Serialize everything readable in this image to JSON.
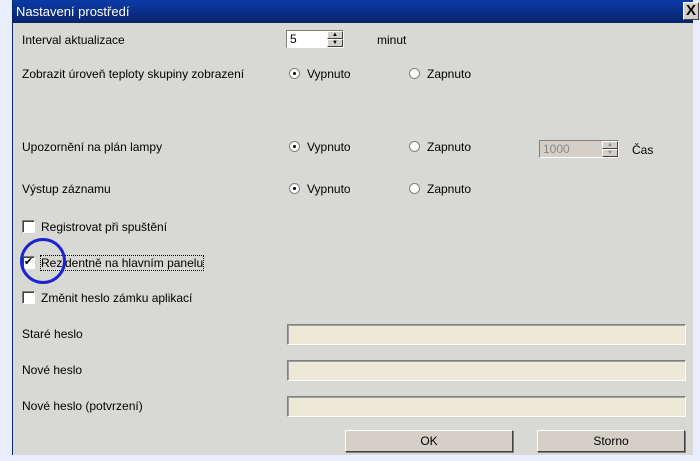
{
  "window": {
    "title": "Nastavení prostředí",
    "close_glyph": "X"
  },
  "update_interval": {
    "label": "Interval aktualizace",
    "value": "5",
    "unit": "minut"
  },
  "temperature": {
    "label": "Zobrazit úroveň teploty skupiny zobrazení",
    "options": [
      "Vypnuto",
      "Zapnuto"
    ],
    "selected": "Vypnuto"
  },
  "lamp": {
    "label": "Upozornění na plán lampy",
    "options": [
      "Vypnuto",
      "Zapnuto"
    ],
    "selected": "Vypnuto",
    "time_value": "1000",
    "time_label": "Čas"
  },
  "log_output": {
    "label": "Výstup záznamu",
    "options": [
      "Vypnuto",
      "Zapnuto"
    ],
    "selected": "Vypnuto"
  },
  "checkboxes": [
    {
      "label": "Registrovat při spuštění",
      "checked": false
    },
    {
      "label": "Rezidentně na hlavním panelu",
      "checked": true
    },
    {
      "label": "Změnit heslo zámku aplikací",
      "checked": false
    }
  ],
  "password": {
    "old_label": "Staré heslo",
    "new_label": "Nové heslo",
    "confirm_label": "Nové heslo (potvrzení)"
  },
  "buttons": {
    "ok": "OK",
    "cancel": "Storno"
  },
  "colors": {
    "titlebar": "#0a246a",
    "dialog_bg": "#d8d8d5",
    "highlight": "#1a24d0"
  }
}
